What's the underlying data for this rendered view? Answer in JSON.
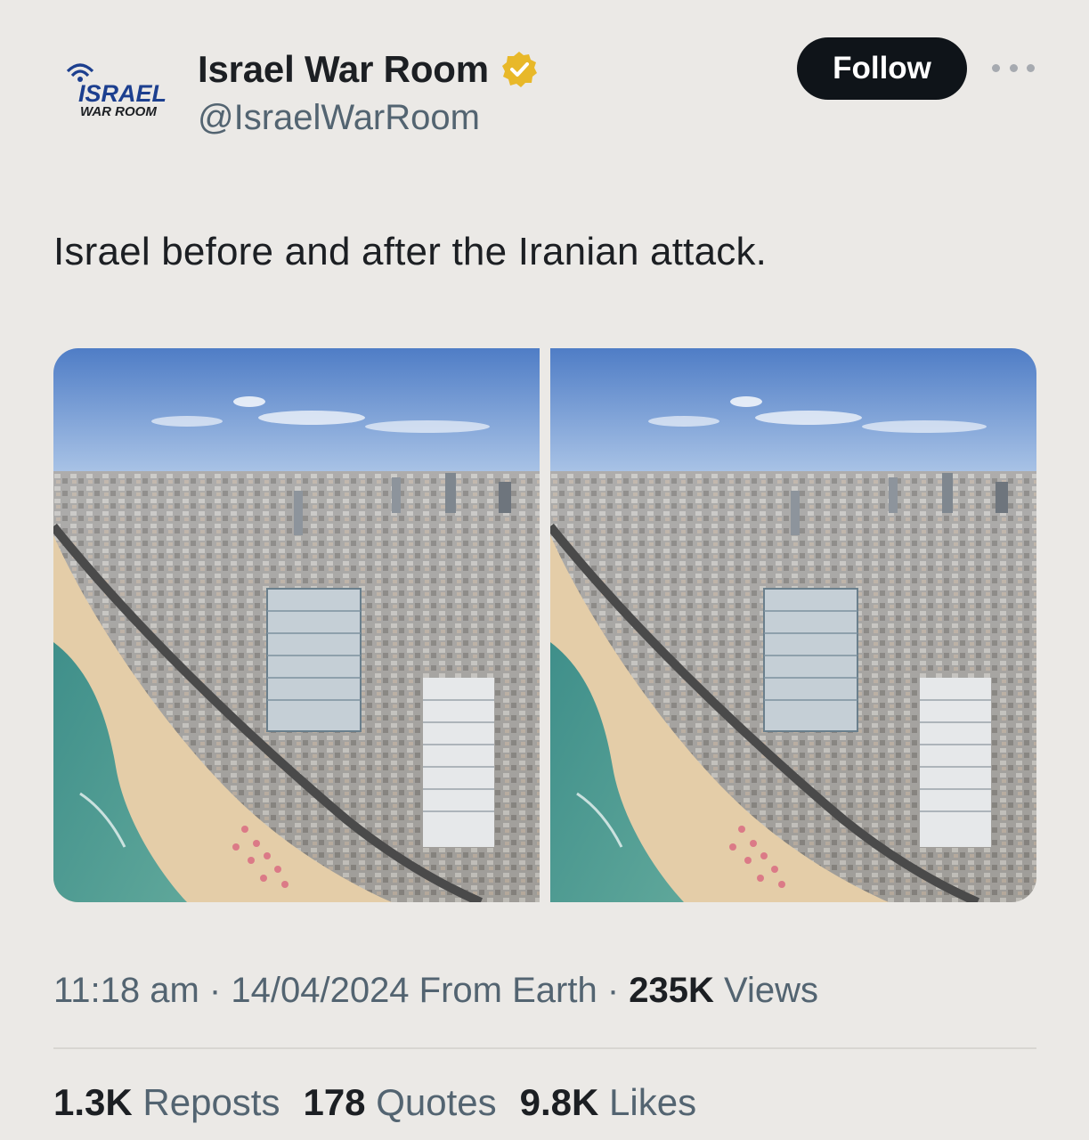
{
  "account": {
    "display_name": "Israel War Room",
    "handle": "@IsraelWarRoom",
    "avatar_text_top": "ISRAEL",
    "avatar_text_bottom": "WAR ROOM",
    "verified_icon": "gold-verified-badge"
  },
  "actions": {
    "follow_label": "Follow",
    "more_icon": "ellipsis-icon"
  },
  "tweet": {
    "text": "Israel before and after the Iranian attack.",
    "media": [
      {
        "description_icon": "aerial-city-beach-photo"
      },
      {
        "description_icon": "aerial-city-beach-photo"
      }
    ]
  },
  "meta": {
    "time": "11:18 am",
    "sep1": " · ",
    "date": "14/04/2024",
    "source": " From Earth",
    "sep2": " · ",
    "views_count": "235K",
    "views_label": " Views"
  },
  "stats": {
    "reposts_count": "1.3K",
    "reposts_label": "Reposts",
    "quotes_count": "178",
    "quotes_label": "Quotes",
    "likes_count": "9.8K",
    "likes_label": "Likes"
  },
  "colors": {
    "background": "#ebe9e6",
    "follow_button": "#0f1419",
    "secondary_text": "#536471",
    "verified_gold": "#e8b829"
  }
}
